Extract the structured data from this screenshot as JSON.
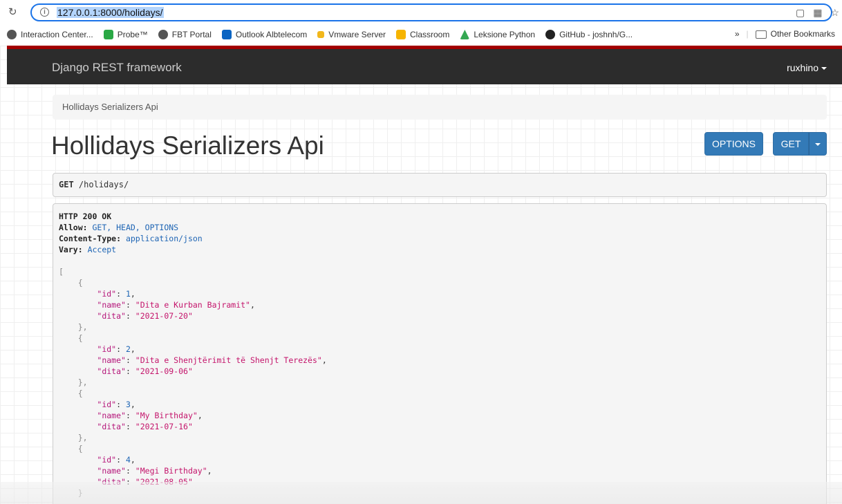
{
  "browser": {
    "url": "127.0.0.1:8000/holidays/",
    "bookmarks": [
      {
        "label": "Interaction Center...",
        "color": "#555555"
      },
      {
        "label": "Probe™",
        "color": "#2aa845"
      },
      {
        "label": "FBT Portal",
        "color": "#555555"
      },
      {
        "label": "Outlook Albtelecom",
        "color": "#0a64c2"
      },
      {
        "label": "Vmware Server",
        "color": "#f2b71b"
      },
      {
        "label": "Classroom",
        "color": "#f6b400"
      },
      {
        "label": "Leksione Python",
        "color": "#34a853"
      },
      {
        "label": "GitHub - joshnh/G...",
        "color": "#222222"
      }
    ],
    "more_bookmarks": "»",
    "other_bookmarks": "Other Bookmarks"
  },
  "navbar": {
    "brand": "Django REST framework",
    "user": "ruxhino"
  },
  "breadcrumb": "Hollidays Serializers Api",
  "page_title": "Hollidays Serializers Api",
  "buttons": {
    "options": "OPTIONS",
    "get": "GET"
  },
  "request": {
    "method": "GET",
    "path": "/holidays/"
  },
  "response": {
    "status": "HTTP 200 OK",
    "headers": [
      {
        "name": "Allow:",
        "value": "GET, HEAD, OPTIONS"
      },
      {
        "name": "Content-Type:",
        "value": "application/json"
      },
      {
        "name": "Vary:",
        "value": "Accept"
      }
    ],
    "items": [
      {
        "id": "1",
        "name": "\"Dita e Kurban Bajramit\"",
        "dita": "\"2021-07-20\""
      },
      {
        "id": "2",
        "name": "\"Dita e Shenjtërimit të Shenjt Terezës\"",
        "dita": "\"2021-09-06\""
      },
      {
        "id": "3",
        "name": "\"My Birthday\"",
        "dita": "\"2021-07-16\""
      },
      {
        "id": "4",
        "name": "\"Megi Birthday\"",
        "dita": "\"2021-08-05\""
      }
    ]
  }
}
